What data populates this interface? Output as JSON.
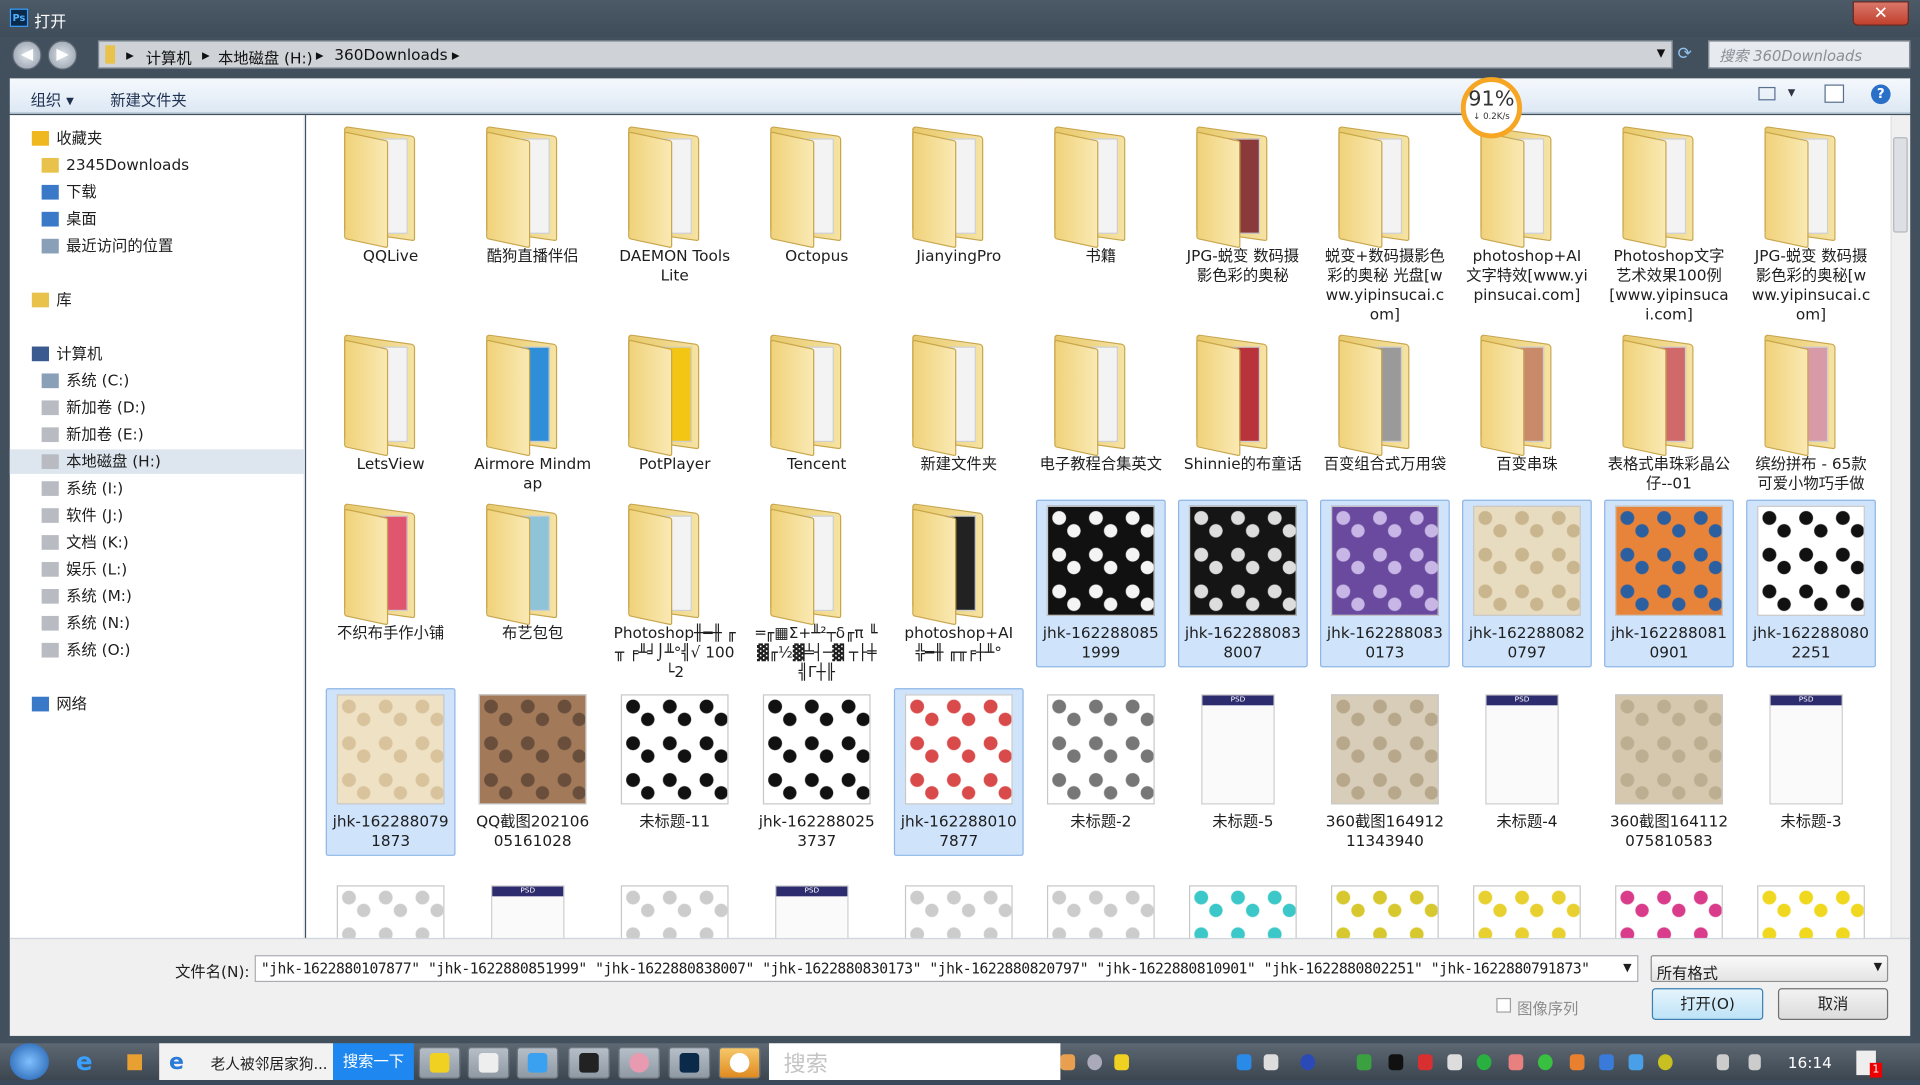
{
  "window": {
    "title": "打开",
    "app_icon": "Ps",
    "close_glyph": "✕"
  },
  "address": {
    "crumbs": [
      "计算机",
      "本地磁盘 (H:)",
      "360Downloads"
    ],
    "search_placeholder": "搜索 360Downloads"
  },
  "toolbar": {
    "organize": "组织 ▾",
    "new_folder": "新建文件夹"
  },
  "badge": {
    "percent": "91%",
    "speed": "↓ 0.2K/s"
  },
  "sidebar": {
    "favorites": {
      "label": "收藏夹",
      "items": [
        "2345Downloads",
        "下载",
        "桌面",
        "最近访问的位置"
      ]
    },
    "library": {
      "label": "库"
    },
    "computer": {
      "label": "计算机",
      "items": [
        "系统 (C:)",
        "新加卷 (D:)",
        "新加卷 (E:)",
        "本地磁盘 (H:)",
        "系统 (I:)",
        "软件 (J:)",
        "文档 (K:)",
        "娱乐 (L:)",
        "系统 (M:)",
        "系统 (N:)",
        "系统 (O:)"
      ],
      "selected": "本地磁盘 (H:)"
    },
    "network": {
      "label": "网络"
    }
  },
  "files": [
    {
      "label": "QQLive",
      "kind": "folder"
    },
    {
      "label": "酷狗直播伴侣",
      "kind": "folder"
    },
    {
      "label": "DAEMON Tools Lite",
      "kind": "folder"
    },
    {
      "label": "Octopus",
      "kind": "folder"
    },
    {
      "label": "JianyingPro",
      "kind": "folder"
    },
    {
      "label": "书籍",
      "kind": "folder"
    },
    {
      "label": "JPG-蜕变 数码摄影色彩的奥秘",
      "kind": "folder",
      "color": "#8a3a3a"
    },
    {
      "label": "蜕变+数码摄影色彩的奥秘 光盘[www.yipinsucai.com]",
      "kind": "folder"
    },
    {
      "label": "photoshop+AI文字特效[www.yipinsucai.com]",
      "kind": "folder"
    },
    {
      "label": "Photoshop文字艺术效果100例[www.yipinsucai.com]",
      "kind": "folder"
    },
    {
      "label": "JPG-蜕变 数码摄影色彩的奥秘[www.yipinsucai.com]",
      "kind": "folder"
    },
    {
      "label": "LetsView",
      "kind": "folder"
    },
    {
      "label": "Airmore Mindmap",
      "kind": "folder",
      "color": "#2f8ed8"
    },
    {
      "label": "PotPlayer",
      "kind": "folder",
      "color": "#f3c514"
    },
    {
      "label": "Tencent",
      "kind": "folder"
    },
    {
      "label": "新建文件夹",
      "kind": "folder"
    },
    {
      "label": "电子教程合集英文",
      "kind": "folder"
    },
    {
      "label": "Shinnie的布童话",
      "kind": "folder",
      "color": "#b8333a"
    },
    {
      "label": "百变组合式万用袋",
      "kind": "folder",
      "color": "#9a9a9a"
    },
    {
      "label": "百变串珠",
      "kind": "folder",
      "color": "#c98a6a"
    },
    {
      "label": "表格式串珠彩晶公仔--01",
      "kind": "folder",
      "color": "#d06a6a"
    },
    {
      "label": "缤纷拼布 - 65款可爱小物巧手做",
      "kind": "folder",
      "color": "#d89aa6"
    },
    {
      "label": "不织布手作小铺",
      "kind": "folder",
      "color": "#e0566e"
    },
    {
      "label": "布艺包包",
      "kind": "folder",
      "color": "#8ec3d8"
    },
    {
      "label": "Photoshop╫━╫ ╓╥ ╒╨╛⌡╨°╣√ 100└2",
      "kind": "folder"
    },
    {
      "label": "═╓▦Σ+╨²┬δ╓π ╙▓╓½▓╧┤─▓ ┬├╪╣Γ┼╟",
      "kind": "folder"
    },
    {
      "label": "photoshop+AI ╬━╫ ╓╥╒┼╨°",
      "kind": "folder",
      "color": "#222222"
    },
    {
      "label": "jhk-1622880851999",
      "kind": "image",
      "color": "#111111",
      "alt": "#f4f4f4",
      "selected": true
    },
    {
      "label": "jhk-1622880838007",
      "kind": "image",
      "color": "#151515",
      "alt": "#dddddd",
      "selected": true
    },
    {
      "label": "jhk-1622880830173",
      "kind": "image",
      "color": "#6a4a9e",
      "alt": "#c7b6e6",
      "selected": true
    },
    {
      "label": "jhk-1622880820797",
      "kind": "image",
      "color": "#e8dcc0",
      "alt": "#c9b58e",
      "selected": true
    },
    {
      "label": "jhk-1622880810901",
      "kind": "image",
      "color": "#e8843a",
      "alt": "#2b5fa0",
      "selected": true
    },
    {
      "label": "jhk-1622880802251",
      "kind": "image",
      "color": "#ffffff",
      "alt": "#111111",
      "selected": true
    },
    {
      "label": "jhk-1622880791873",
      "kind": "image",
      "color": "#efe1c4",
      "alt": "#d8c39c",
      "selected": true
    },
    {
      "label": "QQ截图20210605161028",
      "kind": "image",
      "color": "#a27a5a",
      "alt": "#6a4e3c"
    },
    {
      "label": "未标题-11",
      "kind": "image",
      "color": "#ffffff",
      "alt": "#111111"
    },
    {
      "label": "jhk-1622880253737",
      "kind": "image",
      "color": "#ffffff",
      "alt": "#111111"
    },
    {
      "label": "jhk-1622880107877",
      "kind": "image",
      "color": "#ffffff",
      "alt": "#d94a4a",
      "selected": true
    },
    {
      "label": "未标题-2",
      "kind": "image",
      "color": "#ffffff",
      "alt": "#777777"
    },
    {
      "label": "未标题-5",
      "kind": "psd"
    },
    {
      "label": "360截图16491211343940",
      "kind": "image",
      "color": "#d8cdb8",
      "alt": "#b7a88c"
    },
    {
      "label": "未标题-4",
      "kind": "psd"
    },
    {
      "label": "360截图164112075810583",
      "kind": "image",
      "color": "#d6c8ae",
      "alt": "#bcae90"
    },
    {
      "label": "未标题-3",
      "kind": "psd"
    },
    {
      "label": "",
      "kind": "image",
      "color": "#ffffff",
      "alt": "#cccccc"
    },
    {
      "label": "",
      "kind": "psd"
    },
    {
      "label": "",
      "kind": "image",
      "color": "#ffffff",
      "alt": "#cccccc"
    },
    {
      "label": "",
      "kind": "psd"
    },
    {
      "label": "",
      "kind": "image",
      "color": "#ffffff",
      "alt": "#cccccc"
    },
    {
      "label": "",
      "kind": "image",
      "color": "#ffffff",
      "alt": "#cccccc"
    },
    {
      "label": "",
      "kind": "image",
      "color": "#ffffff",
      "alt": "#3cc8c8"
    },
    {
      "label": "",
      "kind": "image",
      "color": "#ffffff",
      "alt": "#d8c830"
    },
    {
      "label": "",
      "kind": "image",
      "color": "#ffffff",
      "alt": "#e8d030"
    },
    {
      "label": "",
      "kind": "image",
      "color": "#ffffff",
      "alt": "#d83c8a"
    },
    {
      "label": "",
      "kind": "image",
      "color": "#ffffff",
      "alt": "#f0d820"
    }
  ],
  "bottom": {
    "filename_label": "文件名(N):",
    "filename_value": "\"jhk-1622880107877\" \"jhk-1622880851999\" \"jhk-1622880838007\" \"jhk-1622880830173\" \"jhk-1622880820797\" \"jhk-1622880810901\" \"jhk-1622880802251\" \"jhk-1622880791873\"",
    "filter": "所有格式",
    "image_sequence": "图像序列",
    "image_sequence_checked": false,
    "open": "打开(O)",
    "cancel": "取消"
  },
  "taskbar": {
    "browser_tab": "老人被邻居家狗...",
    "search_button": "搜索一下",
    "search_placeholder": "搜索",
    "clock": "16:14",
    "notification_count": "1"
  }
}
